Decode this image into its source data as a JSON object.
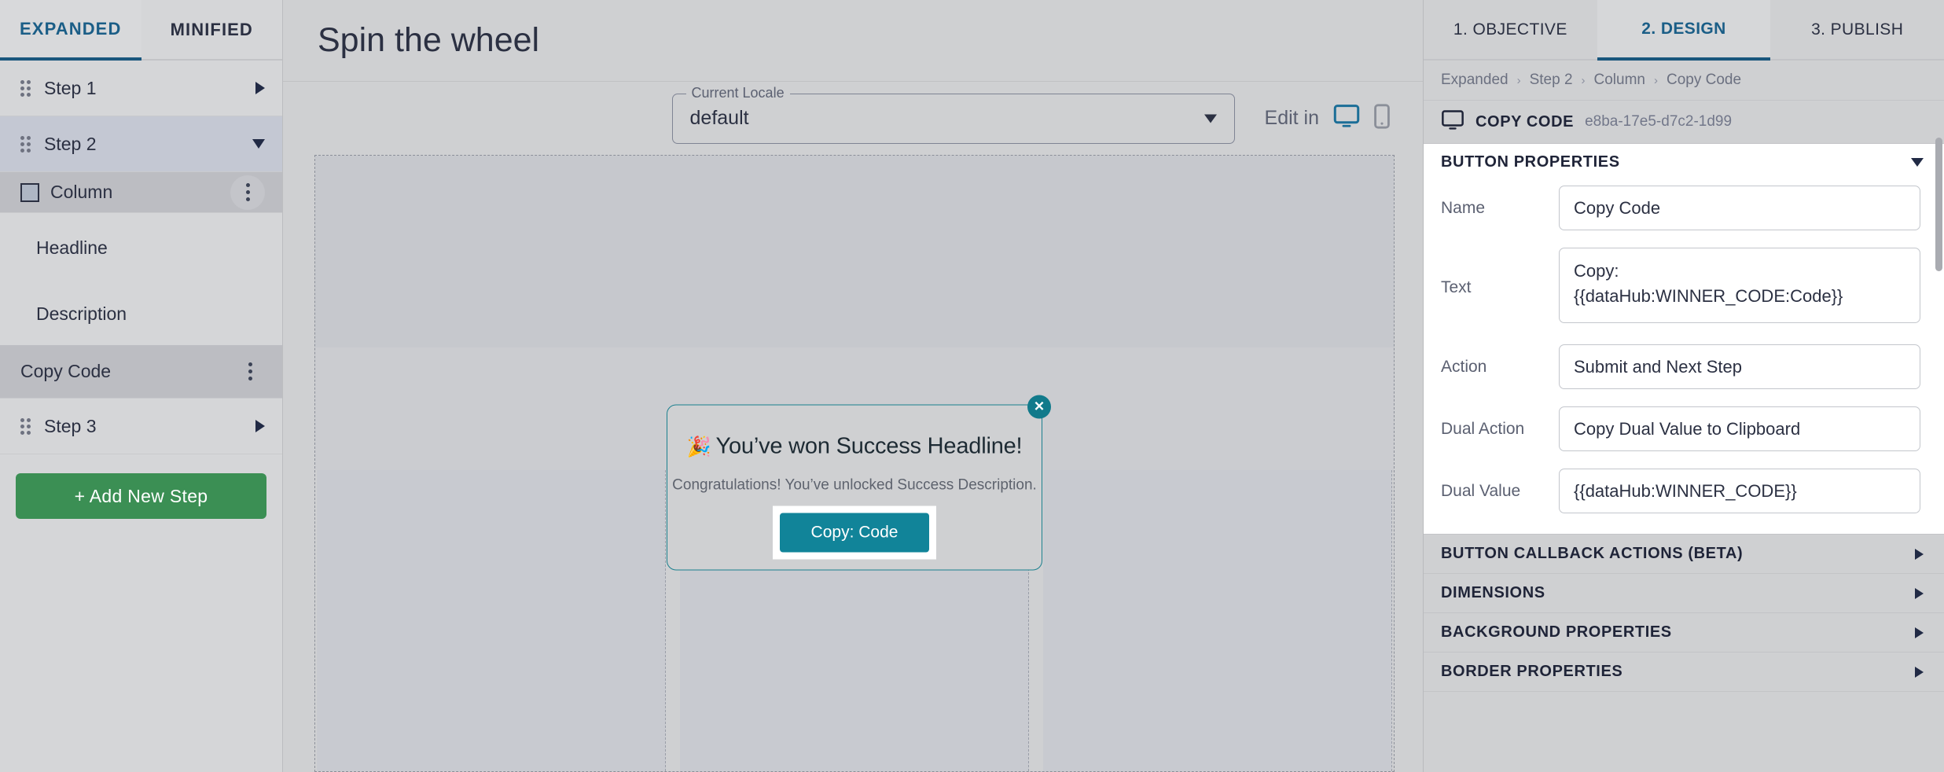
{
  "sidebar": {
    "tabs": [
      {
        "label": "EXPANDED",
        "active": true
      },
      {
        "label": "MINIFIED",
        "active": false
      }
    ],
    "items": [
      {
        "label": "Step 1",
        "type": "step",
        "state": "collapsed"
      },
      {
        "label": "Step 2",
        "type": "step",
        "state": "expanded"
      },
      {
        "label": "Column",
        "type": "column",
        "state": "selected"
      },
      {
        "label": "Headline",
        "type": "element"
      },
      {
        "label": "Description",
        "type": "element"
      },
      {
        "label": "Copy Code",
        "type": "element",
        "state": "selected"
      },
      {
        "label": "Step 3",
        "type": "step",
        "state": "collapsed"
      }
    ],
    "add_step_label": "+ Add New Step"
  },
  "center": {
    "page_title": "Spin the wheel",
    "locale": {
      "legend": "Current Locale",
      "value": "default",
      "options": [
        "default"
      ]
    },
    "edit_in": {
      "label": "Edit in",
      "desktop_icon": "desktop-icon",
      "mobile_icon": "mobile-icon",
      "active_device": "desktop"
    },
    "preview_modal": {
      "close_label": "✕",
      "emoji": "🎉",
      "headline": "You’ve won Success Headline!",
      "description": "Congratulations! You’ve unlocked Success Description.",
      "button_label": "Copy: Code"
    }
  },
  "right_panel": {
    "tabs": [
      {
        "label": "1. OBJECTIVE",
        "active": false
      },
      {
        "label": "2. DESIGN",
        "active": true
      },
      {
        "label": "3. PUBLISH",
        "active": false
      }
    ],
    "breadcrumb": [
      "Expanded",
      "Step 2",
      "Column",
      "Copy Code"
    ],
    "breadcrumb_separator": "›",
    "selected_element": {
      "icon": "desktop-icon",
      "name": "COPY CODE",
      "uid": "e8ba-17e5-d7c2-1d99"
    },
    "button_properties": {
      "title": "BUTTON PROPERTIES",
      "expanded": true,
      "fields": [
        {
          "label": "Name",
          "type": "text",
          "value": "Copy Code"
        },
        {
          "label": "Text",
          "type": "textarea",
          "value": "Copy:\n{{dataHub:WINNER_CODE:Code}}"
        },
        {
          "label": "Action",
          "type": "select",
          "value": "Submit and Next Step"
        },
        {
          "label": "Dual Action",
          "type": "select",
          "value": "Copy Dual Value to Clipboard"
        },
        {
          "label": "Dual Value",
          "type": "text",
          "value": "{{dataHub:WINNER_CODE}}"
        }
      ]
    },
    "collapsed_sections": [
      {
        "label": "BUTTON CALLBACK ACTIONS (BETA)"
      },
      {
        "label": "DIMENSIONS"
      },
      {
        "label": "BACKGROUND PROPERTIES"
      },
      {
        "label": "BORDER PROPERTIES"
      }
    ]
  },
  "colors": {
    "accent_blue": "#19567d",
    "teal": "#118499",
    "green": "#3b8f54",
    "panel_bg": "#cfd0d2"
  }
}
